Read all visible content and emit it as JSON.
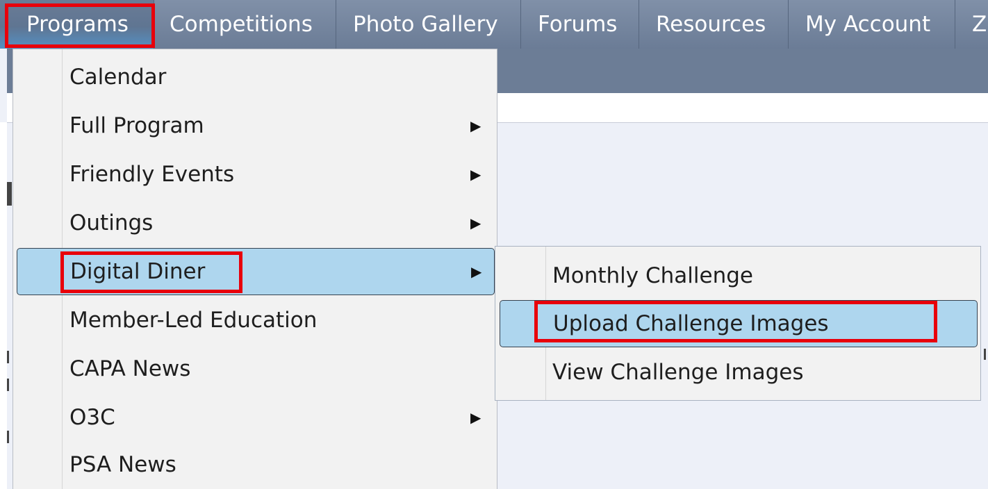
{
  "nav": {
    "items": [
      {
        "label": "Programs"
      },
      {
        "label": "Competitions"
      },
      {
        "label": "Photo Gallery"
      },
      {
        "label": "Forums"
      },
      {
        "label": "Resources"
      },
      {
        "label": "My Account"
      },
      {
        "label": "Zo"
      }
    ]
  },
  "menu": {
    "items": [
      {
        "label": "Calendar",
        "has_submenu": false
      },
      {
        "label": "Full Program",
        "has_submenu": true
      },
      {
        "label": "Friendly Events",
        "has_submenu": true
      },
      {
        "label": "Outings",
        "has_submenu": true
      },
      {
        "label": "Digital Diner",
        "has_submenu": true,
        "highlighted": true
      },
      {
        "label": "Member-Led Education",
        "has_submenu": false
      },
      {
        "label": "CAPA News",
        "has_submenu": false
      },
      {
        "label": "O3C",
        "has_submenu": true
      },
      {
        "label": "PSA News",
        "has_submenu": false
      }
    ],
    "arrow_glyph": "▶"
  },
  "submenu": {
    "items": [
      {
        "label": "Monthly Challenge"
      },
      {
        "label": "Upload Challenge Images",
        "highlighted": true
      },
      {
        "label": "View Challenge Images"
      }
    ]
  },
  "colors": {
    "nav_bg": "#7587a0",
    "menu_bg": "#f2f2f2",
    "highlight": "#aed6ee",
    "annotation_red": "#e8000b"
  }
}
